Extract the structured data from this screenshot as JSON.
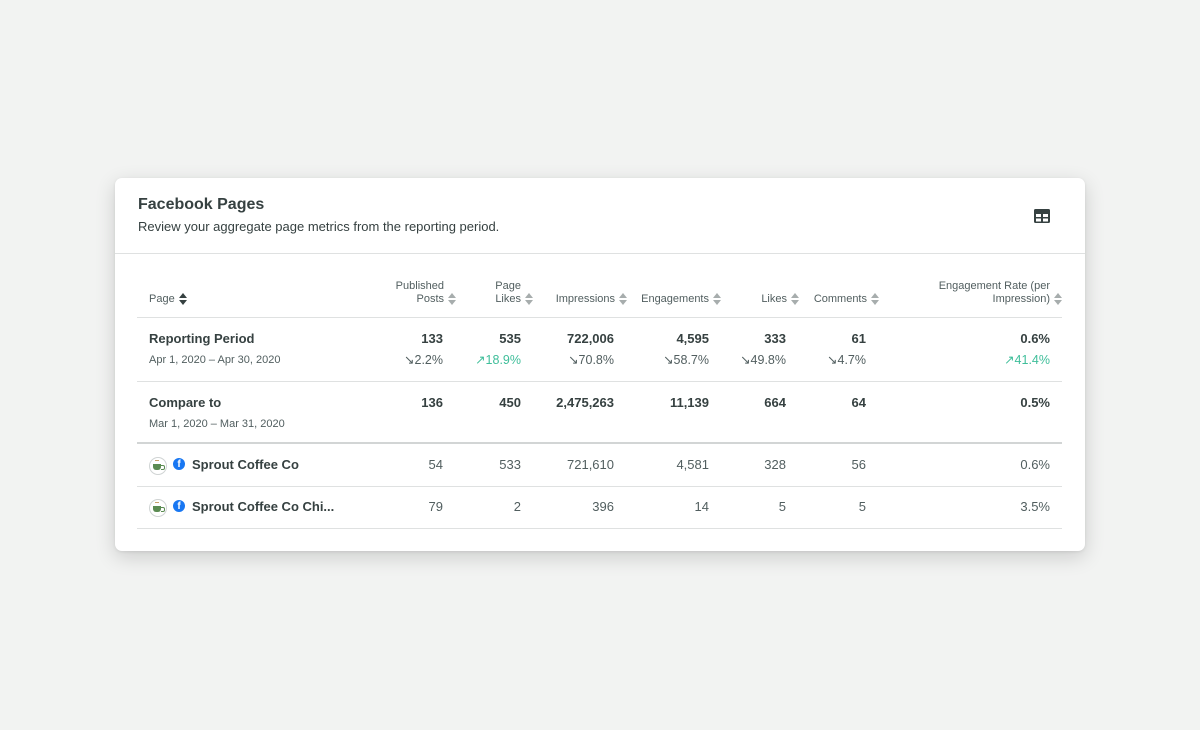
{
  "card": {
    "title": "Facebook Pages",
    "subtitle": "Review your aggregate page metrics from the reporting period.",
    "view_icon": "table-grid-icon"
  },
  "headers": {
    "page": "Page",
    "published_l1": "Published",
    "published_l2": "Posts",
    "page_likes_l1": "Page",
    "page_likes_l2": "Likes",
    "impressions": "Impressions",
    "engagements": "Engagements",
    "likes": "Likes",
    "comments": "Comments",
    "rate_l1": "Engagement Rate (per",
    "rate_l2": "Impression)"
  },
  "reporting": {
    "title": "Reporting Period",
    "dates": "Apr 1, 2020 – Apr 30, 2020",
    "published": "133",
    "page_likes": "535",
    "impressions": "722,006",
    "engagements": "4,595",
    "likes": "333",
    "comments": "61",
    "rate": "0.6%",
    "d_published": "↘2.2%",
    "d_page_likes": "↗18.9%",
    "d_impressions": "↘70.8%",
    "d_engagements": "↘58.7%",
    "d_likes": "↘49.8%",
    "d_comments": "↘4.7%",
    "d_rate": "↗41.4%"
  },
  "compare": {
    "title": "Compare to",
    "dates": "Mar 1, 2020 – Mar 31, 2020",
    "published": "136",
    "page_likes": "450",
    "impressions": "2,475,263",
    "engagements": "11,139",
    "likes": "664",
    "comments": "64",
    "rate": "0.5%"
  },
  "pages": [
    {
      "name": "Sprout Coffee Co",
      "published": "54",
      "page_likes": "533",
      "impressions": "721,610",
      "engagements": "4,581",
      "likes": "328",
      "comments": "56",
      "rate": "0.6%"
    },
    {
      "name": "Sprout Coffee Co Chi...",
      "published": "79",
      "page_likes": "2",
      "impressions": "396",
      "engagements": "14",
      "likes": "5",
      "comments": "5",
      "rate": "3.5%"
    }
  ],
  "colors": {
    "positive": "#3fbe9a",
    "text": "#364141",
    "facebook": "#1877f2"
  }
}
